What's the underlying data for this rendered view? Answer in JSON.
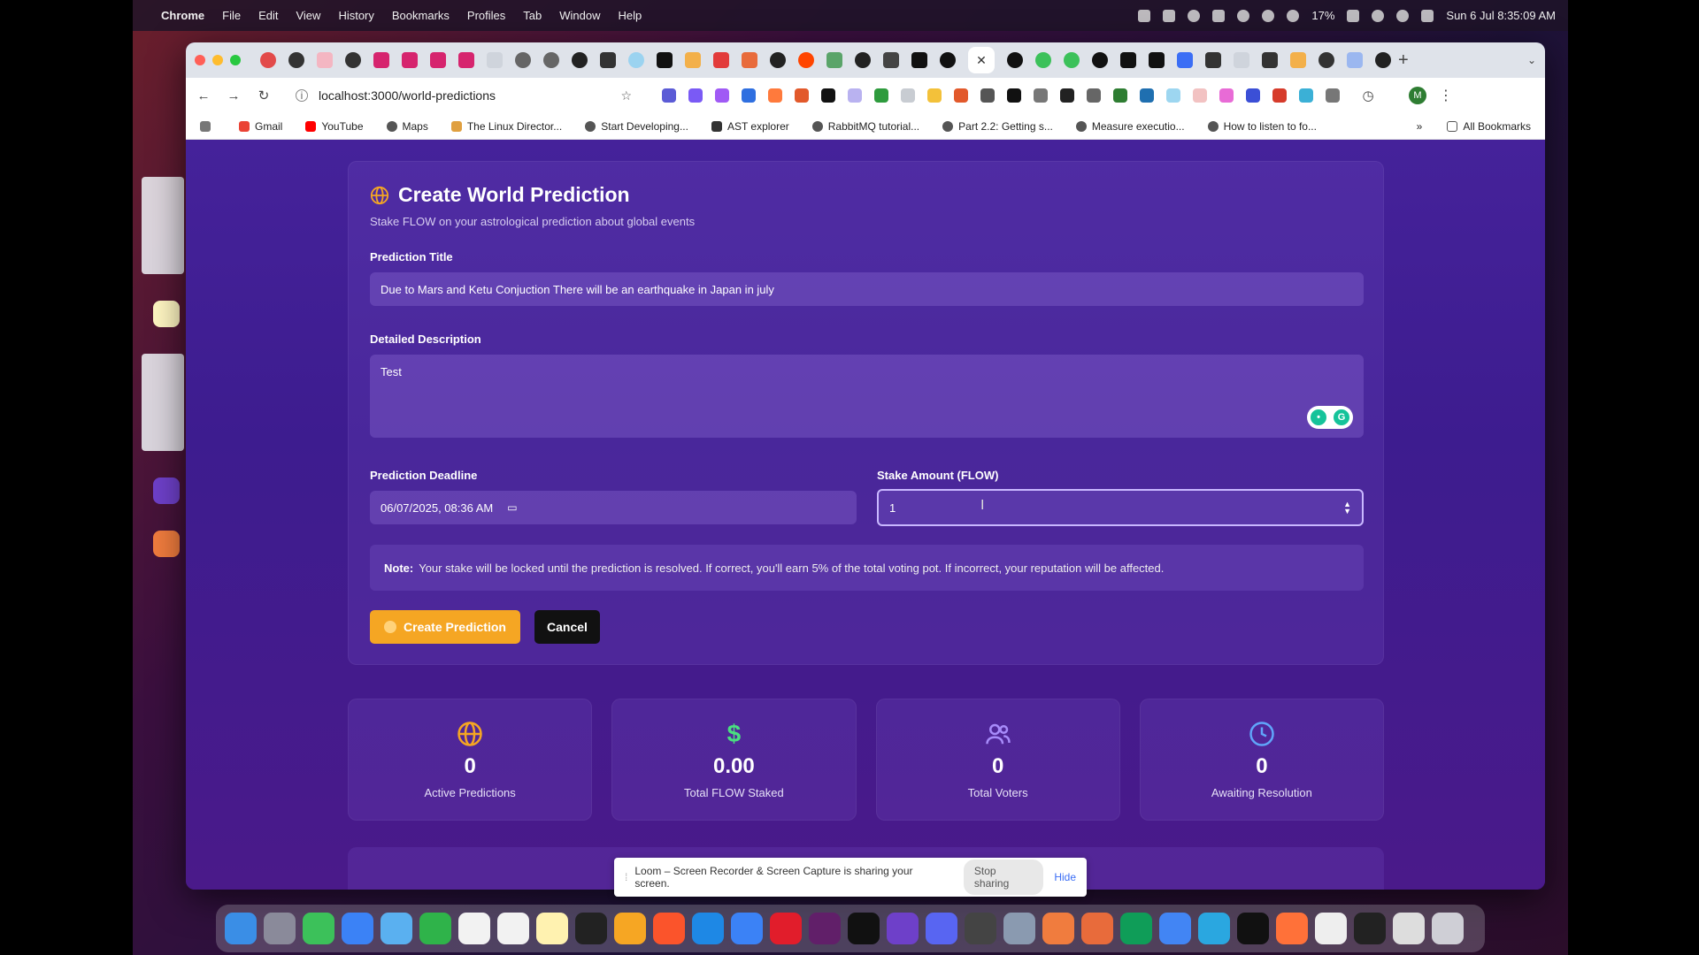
{
  "menubar": {
    "app": "Chrome",
    "items": [
      "File",
      "Edit",
      "View",
      "History",
      "Bookmarks",
      "Profiles",
      "Tab",
      "Window",
      "Help"
    ],
    "battery": "17%",
    "datetime": "Sun 6 Jul  8:35:09 AM"
  },
  "browser": {
    "url": "localhost:3000/world-predictions",
    "bookmarks": [
      "Gmail",
      "YouTube",
      "Maps",
      "The Linux Director...",
      "Start Developing...",
      "AST explorer",
      "RabbitMQ tutorial...",
      "Part 2.2: Getting s...",
      "Measure executio...",
      "How to listen to fo..."
    ],
    "all_bookmarks": "All Bookmarks",
    "profile_initial": "M"
  },
  "form": {
    "title": "Create World Prediction",
    "subtitle": "Stake FLOW on your astrological prediction about global events",
    "title_label": "Prediction Title",
    "title_value": "Due to Mars and Ketu Conjuction There will be an earthquake in Japan in july",
    "description_label": "Detailed Description",
    "description_value": "Test",
    "deadline_label": "Prediction Deadline",
    "deadline_value": "06/07/2025, 08:36 AM",
    "stake_label": "Stake Amount (FLOW)",
    "stake_value": "1",
    "note_label": "Note:",
    "note_text": "Your stake will be locked until the prediction is resolved. If correct, you'll earn 5% of the total voting pot. If incorrect, your reputation will be affected.",
    "create_button": "Create Prediction",
    "cancel_button": "Cancel"
  },
  "stats": [
    {
      "icon": "globe-icon",
      "value": "0",
      "label": "Active Predictions",
      "color": "#f5a623"
    },
    {
      "icon": "dollar-icon",
      "value": "0.00",
      "label": "Total FLOW Staked",
      "color": "#4ade80"
    },
    {
      "icon": "users-icon",
      "value": "0",
      "label": "Total Voters",
      "color": "#a78bfa"
    },
    {
      "icon": "clock-icon",
      "value": "0",
      "label": "Awaiting Resolution",
      "color": "#60a5fa"
    }
  ],
  "loom": {
    "message": "Loom – Screen Recorder & Screen Capture is sharing your screen.",
    "stop": "Stop sharing",
    "hide": "Hide"
  },
  "colors": {
    "accent": "#f5a623",
    "page_bg": "#45229a"
  }
}
